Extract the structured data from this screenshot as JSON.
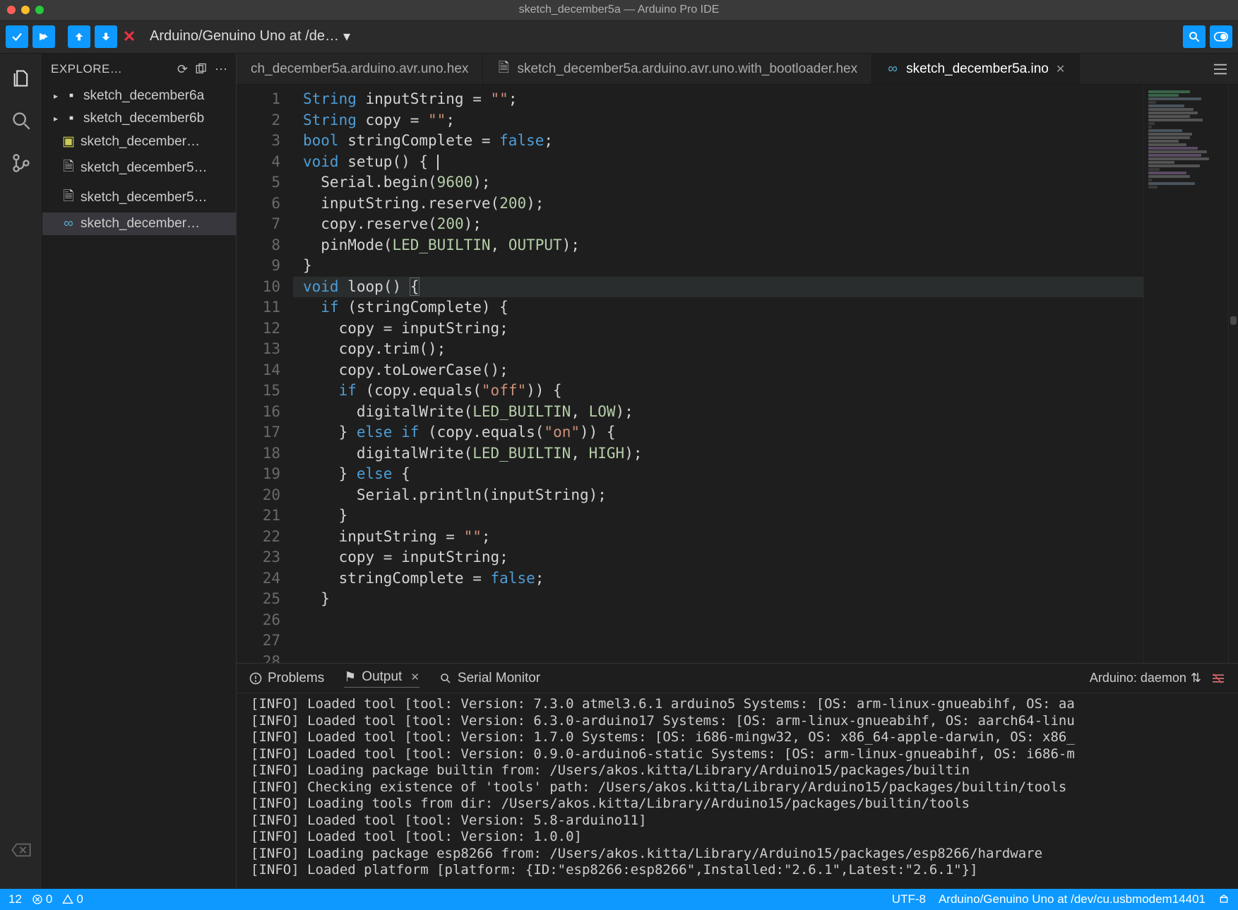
{
  "window": {
    "title": "sketch_december5a — Arduino Pro IDE"
  },
  "toolbar": {
    "board_label": "Arduino/Genuino Uno at /de…"
  },
  "sidebar": {
    "title": "EXPLORE…",
    "items": [
      {
        "label": "sketch_december6a",
        "type": "folder"
      },
      {
        "label": "sketch_december6b",
        "type": "folder"
      },
      {
        "label": "sketch_december…",
        "type": "cfg"
      },
      {
        "label": "sketch_december5…",
        "type": "file"
      },
      {
        "label": "sketch_december5…",
        "type": "file"
      },
      {
        "label": "sketch_december…",
        "type": "link"
      }
    ]
  },
  "tabs": [
    {
      "label": "ch_december5a.arduino.avr.uno.hex",
      "icon": "file",
      "active": false,
      "closable": false
    },
    {
      "label": "sketch_december5a.arduino.avr.uno.with_bootloader.hex",
      "icon": "file",
      "active": false,
      "closable": false
    },
    {
      "label": "sketch_december5a.ino",
      "icon": "link",
      "active": true,
      "closable": true
    }
  ],
  "code_lines": [
    "String inputString = \"\";",
    "String copy = \"\";",
    "bool stringComplete = false;",
    "",
    "void setup() {",
    "  Serial.begin(9600);",
    "  inputString.reserve(200);",
    "  copy.reserve(200);",
    "  pinMode(LED_BUILTIN, OUTPUT);",
    "}",
    "",
    "void loop() {",
    "  if (stringComplete) {",
    "    copy = inputString;",
    "    copy.trim();",
    "    copy.toLowerCase();",
    "    if (copy.equals(\"off\")) {",
    "      digitalWrite(LED_BUILTIN, LOW);",
    "    } else if (copy.equals(\"on\")) {",
    "      digitalWrite(LED_BUILTIN, HIGH);",
    "    } else {",
    "      Serial.println(inputString);",
    "    }",
    "    inputString = \"\";",
    "    copy = inputString;",
    "",
    "    stringComplete = false;",
    "  }"
  ],
  "current_line": 12,
  "panel": {
    "tabs": {
      "problems": "Problems",
      "output": "Output",
      "serial": "Serial Monitor"
    },
    "channel": "Arduino: daemon",
    "lines": [
      "[INFO] Loaded tool [tool: Version: 7.3.0 atmel3.6.1 arduino5 Systems: [OS: arm-linux-gnueabihf, OS: aa",
      "[INFO] Loaded tool [tool: Version: 6.3.0-arduino17 Systems: [OS: arm-linux-gnueabihf, OS: aarch64-linu",
      "[INFO] Loaded tool [tool: Version: 1.7.0 Systems: [OS: i686-mingw32, OS: x86_64-apple-darwin, OS: x86_",
      "[INFO] Loaded tool [tool: Version: 0.9.0-arduino6-static Systems: [OS: arm-linux-gnueabihf, OS: i686-m",
      "[INFO] Loading package builtin from: /Users/akos.kitta/Library/Arduino15/packages/builtin",
      "[INFO] Checking existence of 'tools' path: /Users/akos.kitta/Library/Arduino15/packages/builtin/tools",
      "[INFO] Loading tools from dir: /Users/akos.kitta/Library/Arduino15/packages/builtin/tools",
      "[INFO] Loaded tool [tool: Version: 5.8-arduino11]",
      "[INFO] Loaded tool [tool: Version: 1.0.0]",
      "[INFO] Loading package esp8266 from: /Users/akos.kitta/Library/Arduino15/packages/esp8266/hardware",
      "[INFO] Loaded platform [platform: {ID:\"esp8266:esp8266\",Installed:\"2.6.1\",Latest:\"2.6.1\"}]"
    ]
  },
  "status": {
    "left_num": "12",
    "errors": "0",
    "warnings": "0",
    "encoding": "UTF-8",
    "board": "Arduino/Genuino Uno at /dev/cu.usbmodem14401"
  },
  "colors": {
    "accent": "#0d99ff"
  }
}
